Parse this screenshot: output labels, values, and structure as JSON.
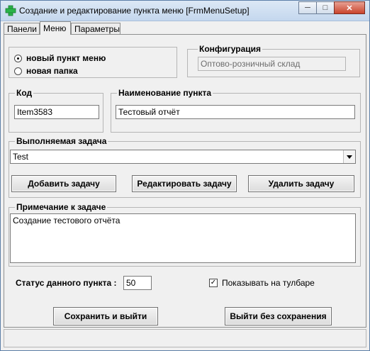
{
  "window": {
    "title": "Создание и редактирование пункта меню [FrmMenuSetup]"
  },
  "tabs": [
    {
      "label": "Панели"
    },
    {
      "label": "Меню"
    },
    {
      "label": "Параметры"
    }
  ],
  "item_type": {
    "new_item_label": "новый пункт меню",
    "new_folder_label": "новая папка",
    "selected": "new_item"
  },
  "config": {
    "label": "Конфигурация",
    "value": "Оптово-розничный склад"
  },
  "code": {
    "label": "Код",
    "value": "Item3583"
  },
  "name": {
    "label": "Наименование пункта",
    "value": "Тестовый отчёт"
  },
  "task": {
    "label": "Выполняемая задача",
    "value": "Test",
    "add_label": "Добавить задачу",
    "edit_label": "Редактировать задачу",
    "delete_label": "Удалить задачу"
  },
  "note": {
    "label": "Примечание к задаче",
    "value": "Создание тестового отчёта"
  },
  "status": {
    "label": "Статус данного пункта :",
    "value": "50"
  },
  "toolbar_checkbox": {
    "label": "Показывать на тулбаре",
    "checked": true
  },
  "footer": {
    "save_label": "Сохранить и выйти",
    "exit_label": "Выйти без сохранения"
  },
  "icons": {
    "app": "plus-icon",
    "dropdown": "chevron-down-icon"
  },
  "colors": {
    "app_icon": "#2bb34a"
  }
}
